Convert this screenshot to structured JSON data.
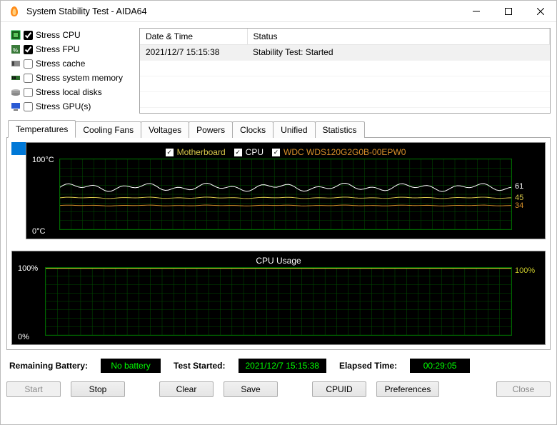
{
  "window": {
    "title": "System Stability Test - AIDA64"
  },
  "stress_options": [
    {
      "label": "Stress CPU",
      "checked": true
    },
    {
      "label": "Stress FPU",
      "checked": true
    },
    {
      "label": "Stress cache",
      "checked": false
    },
    {
      "label": "Stress system memory",
      "checked": false
    },
    {
      "label": "Stress local disks",
      "checked": false
    },
    {
      "label": "Stress GPU(s)",
      "checked": false
    }
  ],
  "events": {
    "col_date": "Date & Time",
    "col_status": "Status",
    "rows": [
      {
        "date": "2021/12/7 15:15:38",
        "status": "Stability Test: Started"
      }
    ]
  },
  "tabs": [
    "Temperatures",
    "Cooling Fans",
    "Voltages",
    "Powers",
    "Clocks",
    "Unified",
    "Statistics"
  ],
  "active_tab": 0,
  "temp_graph": {
    "legend": [
      {
        "label": "Motherboard",
        "color": "#d8c84a",
        "checked": true
      },
      {
        "label": "CPU",
        "color": "#ffffff",
        "checked": true
      },
      {
        "label": "WDC WDS120G2G0B-00EPW0",
        "color": "#d8902a",
        "checked": true
      }
    ],
    "y_max_label": "100°C",
    "y_min_label": "0°C",
    "readouts": [
      {
        "value": "61",
        "pct": 39,
        "color": "#ffffff"
      },
      {
        "value": "45",
        "pct": 55,
        "color": "#d8c84a"
      },
      {
        "value": "34",
        "pct": 66,
        "color": "#d8902a"
      }
    ]
  },
  "cpu_graph": {
    "title": "CPU Usage",
    "y_max_label": "100%",
    "y_min_label": "0%",
    "readouts": [
      {
        "value": "100%",
        "pct": 0,
        "color": "#c8c82a"
      }
    ]
  },
  "status": {
    "battery_label": "Remaining Battery:",
    "battery_value": "No battery",
    "started_label": "Test Started:",
    "started_value": "2021/12/7 15:15:38",
    "elapsed_label": "Elapsed Time:",
    "elapsed_value": "00:29:05"
  },
  "buttons": {
    "start": "Start",
    "stop": "Stop",
    "clear": "Clear",
    "save": "Save",
    "cpuid": "CPUID",
    "prefs": "Preferences",
    "close": "Close"
  },
  "chart_data": [
    {
      "type": "line",
      "title": "Temperatures",
      "ylabel": "°C",
      "ylim": [
        0,
        100
      ],
      "series": [
        {
          "name": "CPU",
          "current": 61,
          "approx_mean": 60,
          "noise": 3
        },
        {
          "name": "Motherboard",
          "current": 45,
          "approx_mean": 45,
          "noise": 0.5
        },
        {
          "name": "WDC WDS120G2G0B-00EPW0",
          "current": 34,
          "approx_mean": 34,
          "noise": 0.3
        }
      ]
    },
    {
      "type": "line",
      "title": "CPU Usage",
      "ylabel": "%",
      "ylim": [
        0,
        100
      ],
      "series": [
        {
          "name": "CPU Usage",
          "current": 100,
          "approx_mean": 100,
          "noise": 0
        }
      ]
    }
  ]
}
